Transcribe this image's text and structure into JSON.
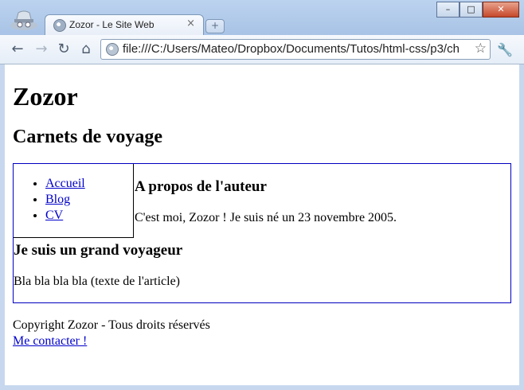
{
  "browser": {
    "tab_title": "Zozor - Le Site Web",
    "tab_close": "×",
    "new_tab": "+",
    "address": "file:///C:/Users/Mateo/Dropbox/Documents/Tutos/html-css/p3/ch",
    "window_buttons": {
      "minimize": "–",
      "maximize": "□",
      "close": "✕"
    }
  },
  "page": {
    "title": "Zozor",
    "subtitle": "Carnets de voyage",
    "nav": [
      "Accueil",
      "Blog",
      "CV"
    ],
    "aside": {
      "title": "A propos de l'auteur",
      "text": "C'est moi, Zozor ! Je suis né un 23 novembre 2005."
    },
    "article": {
      "title": "Je suis un grand voyageur",
      "text": "Bla bla bla bla (texte de l'article)"
    },
    "footer": {
      "copyright": "Copyright Zozor - Tous droits réservés",
      "contact": "Me contacter !"
    }
  }
}
